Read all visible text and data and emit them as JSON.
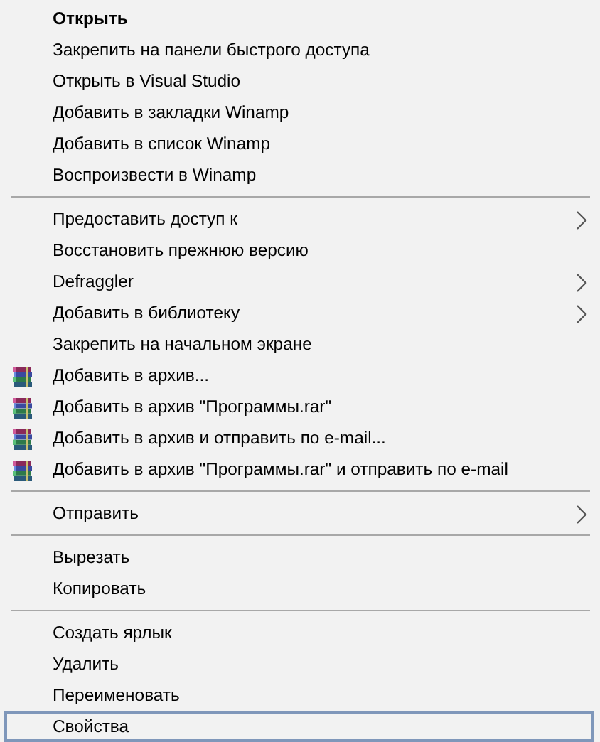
{
  "menu": {
    "groups": [
      [
        {
          "label": "Открыть",
          "kind": "plain",
          "default": true,
          "submenu": false,
          "selected": false
        },
        {
          "label": "Закрепить на панели быстрого доступа",
          "kind": "plain",
          "default": false,
          "submenu": false,
          "selected": false
        },
        {
          "label": "Открыть в Visual Studio",
          "kind": "plain",
          "default": false,
          "submenu": false,
          "selected": false
        },
        {
          "label": "Добавить в закладки Winamp",
          "kind": "plain",
          "default": false,
          "submenu": false,
          "selected": false
        },
        {
          "label": "Добавить в список Winamp",
          "kind": "plain",
          "default": false,
          "submenu": false,
          "selected": false
        },
        {
          "label": "Воспроизвести в Winamp",
          "kind": "plain",
          "default": false,
          "submenu": false,
          "selected": false
        }
      ],
      [
        {
          "label": "Предоставить доступ к",
          "kind": "plain",
          "default": false,
          "submenu": true,
          "selected": false
        },
        {
          "label": "Восстановить прежнюю версию",
          "kind": "plain",
          "default": false,
          "submenu": false,
          "selected": false
        },
        {
          "label": "Defraggler",
          "kind": "plain",
          "default": false,
          "submenu": true,
          "selected": false
        },
        {
          "label": "Добавить в библиотеку",
          "kind": "plain",
          "default": false,
          "submenu": true,
          "selected": false
        },
        {
          "label": "Закрепить на начальном экране",
          "kind": "plain",
          "default": false,
          "submenu": false,
          "selected": false
        },
        {
          "label": "Добавить в архив...",
          "kind": "archive",
          "default": false,
          "submenu": false,
          "selected": false
        },
        {
          "label": "Добавить в архив \"Программы.rar\"",
          "kind": "archive",
          "default": false,
          "submenu": false,
          "selected": false
        },
        {
          "label": "Добавить в архив и отправить по e-mail...",
          "kind": "archive",
          "default": false,
          "submenu": false,
          "selected": false
        },
        {
          "label": "Добавить в архив \"Программы.rar\" и отправить по e-mail",
          "kind": "archive",
          "default": false,
          "submenu": false,
          "selected": false
        }
      ],
      [
        {
          "label": "Отправить",
          "kind": "plain",
          "default": false,
          "submenu": true,
          "selected": false
        }
      ],
      [
        {
          "label": "Вырезать",
          "kind": "plain",
          "default": false,
          "submenu": false,
          "selected": false
        },
        {
          "label": "Копировать",
          "kind": "plain",
          "default": false,
          "submenu": false,
          "selected": false
        }
      ],
      [
        {
          "label": "Создать ярлык",
          "kind": "plain",
          "default": false,
          "submenu": false,
          "selected": false
        },
        {
          "label": "Удалить",
          "kind": "plain",
          "default": false,
          "submenu": false,
          "selected": false
        },
        {
          "label": "Переименовать",
          "kind": "plain",
          "default": false,
          "submenu": false,
          "selected": false
        },
        {
          "label": "Свойства",
          "kind": "plain",
          "default": false,
          "submenu": false,
          "selected": true
        }
      ]
    ]
  }
}
